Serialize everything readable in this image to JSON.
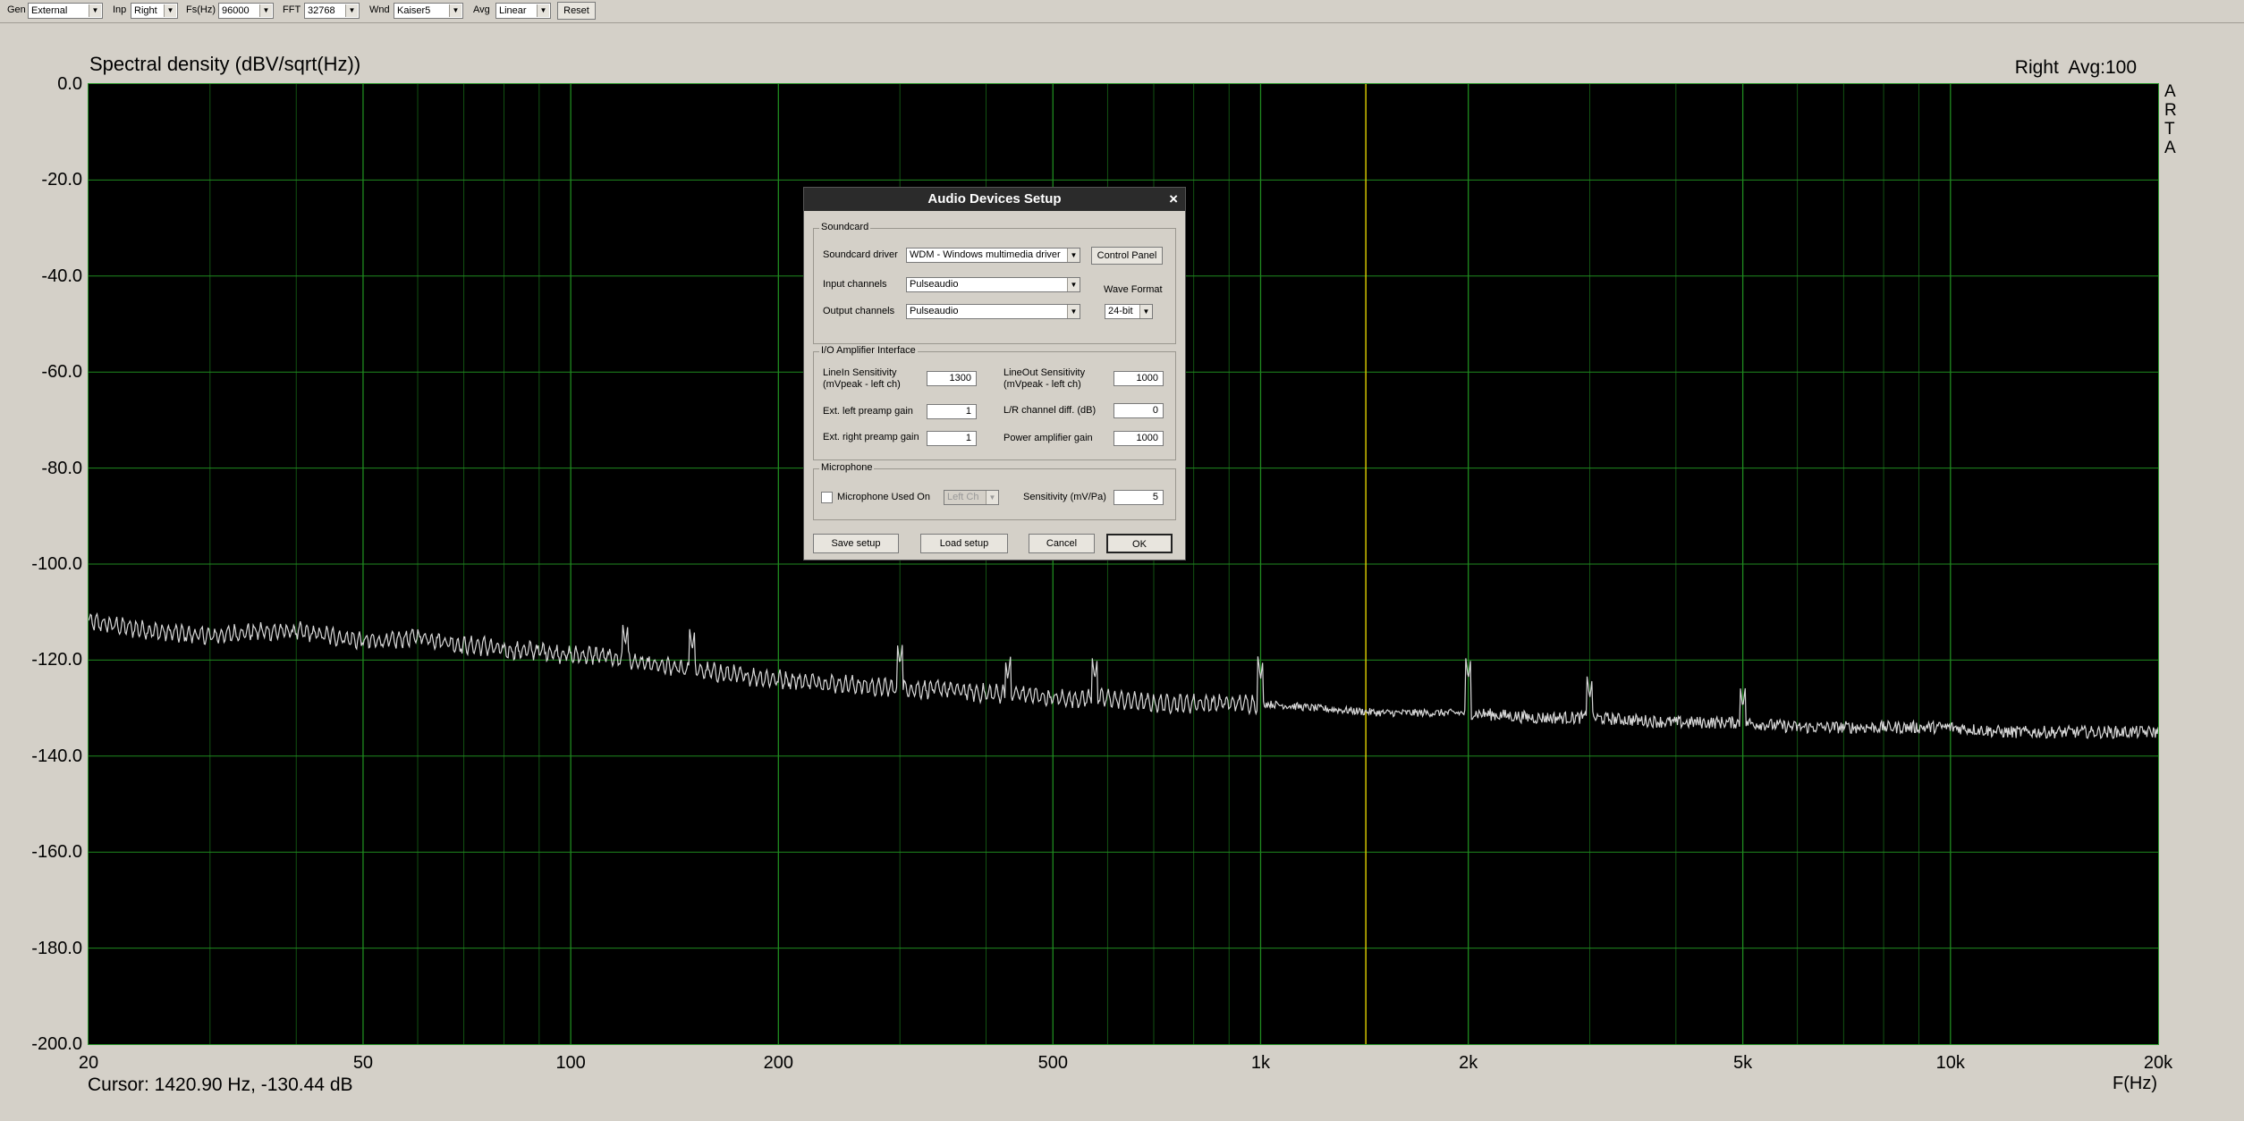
{
  "toolbar": {
    "gen_label": "Gen",
    "gen_value": "External",
    "inp_label": "Inp",
    "inp_value": "Right",
    "fs_label": "Fs(Hz)",
    "fs_value": "96000",
    "fft_label": "FFT",
    "fft_value": "32768",
    "wnd_label": "Wnd",
    "wnd_value": "Kaiser5",
    "avg_label": "Avg",
    "avg_value": "Linear",
    "reset_label": "Reset"
  },
  "chart_title": "Spectral density (dBV/sqrt(Hz))",
  "channel_info": "Right  Avg:100",
  "arta_letters": [
    "A",
    "R",
    "T",
    "A"
  ],
  "cursor_readout": "Cursor: 1420.90 Hz, -130.44 dB",
  "colors": {
    "grid": "#1f8a1f",
    "trace": "#d8d8d8",
    "cursor": "#d4c400",
    "plot_bg": "#000000",
    "window_bg": "#d4d0c8"
  },
  "chart_data": {
    "type": "line",
    "title": "Spectral density (dBV/sqrt(Hz))",
    "xlabel": "F(Hz)",
    "ylabel": "",
    "x_scale": "log",
    "xlim": [
      20,
      20000
    ],
    "ylim": [
      -200,
      0
    ],
    "grid": true,
    "y_ticks": [
      "0.0",
      "-20.0",
      "-40.0",
      "-60.0",
      "-80.0",
      "-100.0",
      "-120.0",
      "-140.0",
      "-160.0",
      "-180.0",
      "-200.0"
    ],
    "x_ticks": [
      {
        "value": 20,
        "label": "20"
      },
      {
        "value": 50,
        "label": "50"
      },
      {
        "value": 100,
        "label": "100"
      },
      {
        "value": 200,
        "label": "200"
      },
      {
        "value": 500,
        "label": "500"
      },
      {
        "value": 1000,
        "label": "1k"
      },
      {
        "value": 2000,
        "label": "2k"
      },
      {
        "value": 5000,
        "label": "5k"
      },
      {
        "value": 10000,
        "label": "10k"
      },
      {
        "value": 20000,
        "label": "20k"
      }
    ],
    "cursor_x": 1420.9,
    "series": [
      {
        "x": [
          20,
          25,
          30,
          35,
          40,
          45,
          50,
          55,
          60,
          65,
          70,
          75,
          80,
          90,
          100,
          110,
          120,
          130,
          150,
          170,
          200,
          250,
          300,
          350,
          400,
          450,
          500,
          600,
          700,
          800,
          900,
          1000,
          1200,
          1500,
          2000,
          2500,
          3000,
          4000,
          5000,
          6000,
          7000,
          8000,
          10000,
          12000,
          15000,
          20000
        ],
        "y": [
          -112,
          -114,
          -115,
          -114,
          -114,
          -115,
          -116,
          -116,
          -115,
          -116,
          -117,
          -117,
          -118,
          -118,
          -119,
          -119,
          -120,
          -121,
          -122,
          -123,
          -124,
          -125,
          -126,
          -126,
          -127,
          -127,
          -128,
          -128,
          -129,
          -129,
          -129,
          -129,
          -130,
          -131,
          -131,
          -132,
          -132,
          -133,
          -133,
          -134,
          -134,
          -134,
          -134,
          -135,
          -135,
          -135
        ]
      }
    ],
    "peaks": [
      {
        "x": 1000,
        "y": -124
      },
      {
        "x": 2000,
        "y": -124
      },
      {
        "x": 3000,
        "y": -128
      },
      {
        "x": 5000,
        "y": -130
      },
      {
        "x": 575,
        "y": -124
      },
      {
        "x": 430,
        "y": -124
      },
      {
        "x": 300,
        "y": -121
      },
      {
        "x": 150,
        "y": -118
      },
      {
        "x": 120,
        "y": -117
      }
    ]
  },
  "dialog": {
    "title": "Audio Devices Setup",
    "close_glyph": "×",
    "soundcard": {
      "group_title": "Soundcard",
      "driver_label": "Soundcard driver",
      "driver_value": "WDM - Windows multimedia driver",
      "control_panel": "Control Panel",
      "input_label": "Input channels",
      "input_value": "Pulseaudio",
      "output_label": "Output channels",
      "output_value": "Pulseaudio",
      "wave_format_label": "Wave Format",
      "wave_format_value": "24-bit"
    },
    "io": {
      "group_title": "I/O Amplifier Interface",
      "linein_label_1": "LineIn Sensitivity",
      "linein_label_2": "(mVpeak - left ch)",
      "linein_value": "1300",
      "lineout_label_1": "LineOut Sensitivity",
      "lineout_label_2": "(mVpeak - left ch)",
      "lineout_value": "1000",
      "ext_left_label": "Ext. left preamp gain",
      "ext_left_value": "1",
      "lr_diff_label": "L/R channel diff. (dB)",
      "lr_diff_value": "0",
      "ext_right_label": "Ext. right preamp gain",
      "ext_right_value": "1",
      "power_amp_label": "Power amplifier gain",
      "power_amp_value": "1000"
    },
    "mic": {
      "group_title": "Microphone",
      "used_on_label": "Microphone Used On",
      "channel_value": "Left Ch",
      "sens_label": "Sensitivity (mV/Pa)",
      "sens_value": "5"
    },
    "buttons": {
      "save": "Save setup",
      "load": "Load setup",
      "cancel": "Cancel",
      "ok": "OK"
    }
  }
}
